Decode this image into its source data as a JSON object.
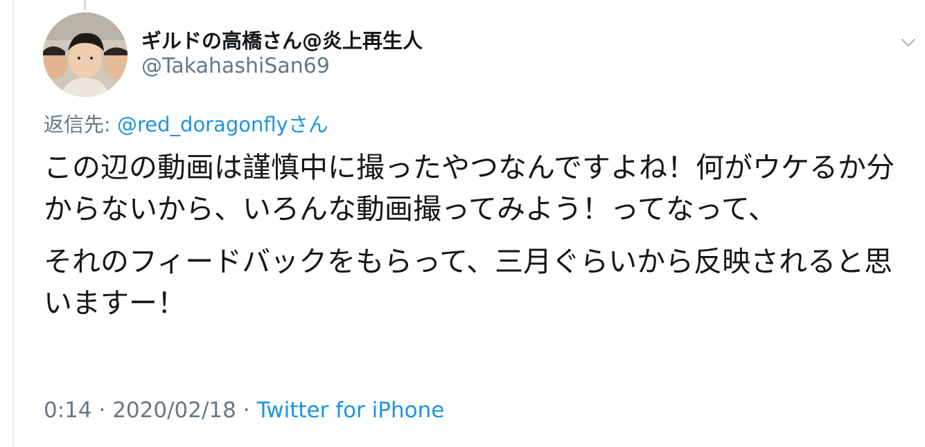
{
  "tweet": {
    "display_name": "ギルドの高橋さん@炎上再生人",
    "handle": "@TakahashiSan69",
    "reply_prefix": "返信先: ",
    "reply_mention": "@red_doragonfly",
    "reply_suffix": "さん",
    "text_paragraphs": [
      "この辺の動画は謹慎中に撮ったやつなんですよね！何がウケるか分からないから、いろんな動画撮ってみよう！ってなって、",
      "それのフィードバックをもらって、三月ぐらいから反映されると思いますー！"
    ],
    "time": "0:14",
    "separator": " · ",
    "date": "2020/02/18",
    "source": "Twitter for iPhone"
  },
  "icons": {
    "avatar": "avatar-photo",
    "more": "chevron-down-icon"
  },
  "colors": {
    "text": "#14171a",
    "secondary": "#657786",
    "link": "#1b95e0",
    "border": "#e6ecf0"
  }
}
